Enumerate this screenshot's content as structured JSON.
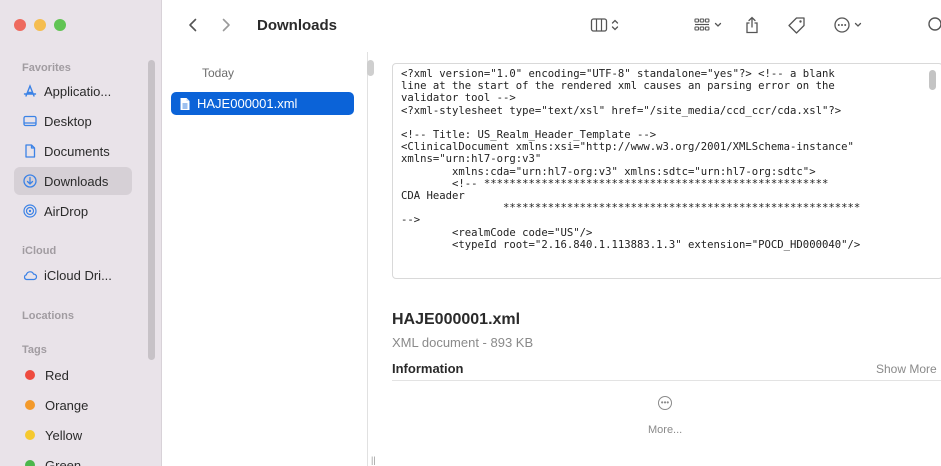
{
  "window": {
    "traffic_colors": [
      "#ee6a5e",
      "#f5bd4f",
      "#61c454"
    ]
  },
  "toolbar": {
    "title": "Downloads",
    "icons": [
      "back-chevron-icon",
      "forward-chevron-icon",
      "column-view-icon",
      "group-icon",
      "share-icon",
      "tag-icon",
      "more-actions-icon",
      "search-icon"
    ]
  },
  "sidebar": {
    "favorites_label": "Favorites",
    "favorites": [
      {
        "label": "Applicatio...",
        "icon": "applications-icon"
      },
      {
        "label": "Desktop",
        "icon": "desktop-icon"
      },
      {
        "label": "Documents",
        "icon": "document-icon"
      },
      {
        "label": "Downloads",
        "icon": "downloads-icon",
        "selected": true
      },
      {
        "label": "AirDrop",
        "icon": "airdrop-icon"
      }
    ],
    "icloud_label": "iCloud",
    "icloud": [
      {
        "label": "iCloud Dri...",
        "icon": "cloud-icon"
      }
    ],
    "locations_label": "Locations",
    "tags_label": "Tags",
    "tags": [
      {
        "label": "Red",
        "color": "#ee4b3f"
      },
      {
        "label": "Orange",
        "color": "#f39a2b"
      },
      {
        "label": "Yellow",
        "color": "#f5c92f"
      },
      {
        "label": "Green",
        "color": "#4cb74c"
      }
    ]
  },
  "files": {
    "group": "Today",
    "items": [
      {
        "name": "HAJE000001.xml",
        "selected": true
      }
    ]
  },
  "preview": {
    "code_lines": [
      "<?xml version=\"1.0\" encoding=\"UTF-8\" standalone=\"yes\"?> <!-- a blank",
      "line at the start of the rendered xml causes an parsing error on the",
      "validator tool -->",
      "<?xml-stylesheet type=\"text/xsl\" href=\"/site_media/ccd_ccr/cda.xsl\"?>",
      "",
      "<!-- Title: US_Realm_Header_Template -->",
      "<ClinicalDocument xmlns:xsi=\"http://www.w3.org/2001/XMLSchema-instance\"",
      "xmlns=\"urn:hl7-org:v3\"",
      "        xmlns:cda=\"urn:hl7-org:v3\" xmlns:sdtc=\"urn:hl7-org:sdtc\">",
      "        <!-- ******************************************************",
      "CDA Header",
      "                ********************************************************",
      "-->",
      "        <realmCode code=\"US\"/>",
      "        <typeId root=\"2.16.840.1.113883.1.3\" extension=\"POCD_HD000040\"/>"
    ],
    "name": "HAJE000001.xml",
    "kind": "XML document - 893 KB",
    "info_title": "Information",
    "show_more": "Show More",
    "more_label": "More..."
  }
}
